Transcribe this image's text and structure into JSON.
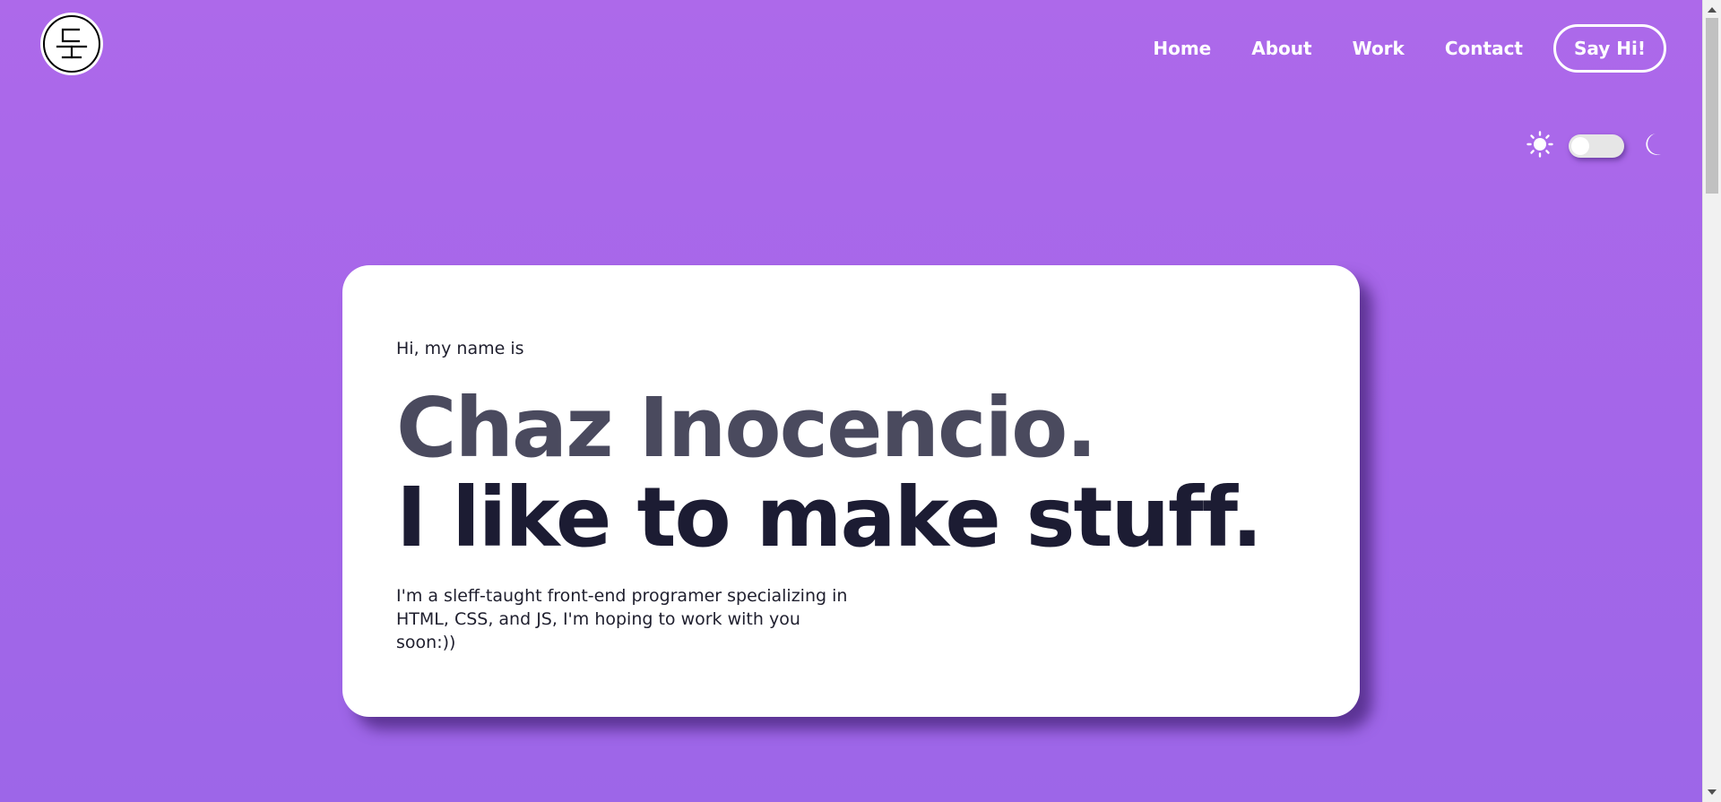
{
  "header": {
    "logo_icon": "monogram-logo-icon",
    "nav": [
      {
        "label": "Home"
      },
      {
        "label": "About"
      },
      {
        "label": "Work"
      },
      {
        "label": "Contact"
      }
    ],
    "cta_label": "Say Hi!"
  },
  "theme_toggle": {
    "left_icon": "sun-icon",
    "right_icon": "moon-icon",
    "state": "light"
  },
  "hero": {
    "greeting": "Hi, my name is",
    "name": "Chaz Inocencio.",
    "tagline": "I like to make stuff.",
    "bio": "I'm a sleff-taught front-end programer specializing in HTML, CSS, and JS, I'm hoping to work with you soon:))"
  },
  "colors": {
    "background": "#a767ea",
    "card": "#ffffff",
    "name": "#4a4a5e",
    "tagline": "#1c1c33"
  }
}
